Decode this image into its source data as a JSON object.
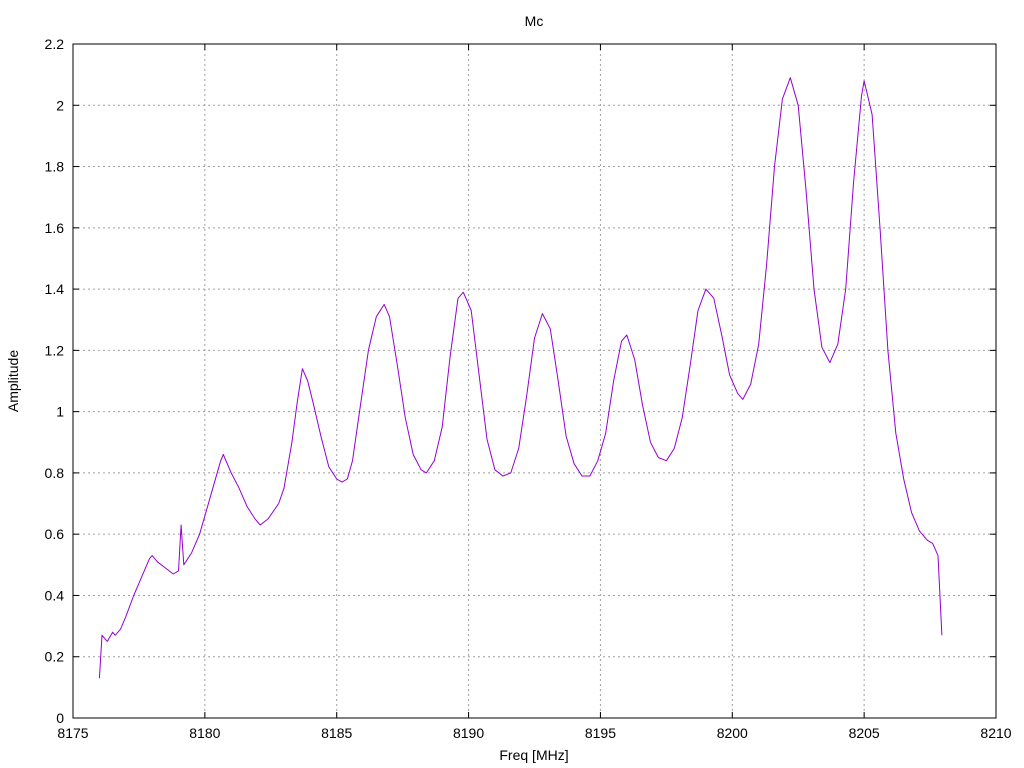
{
  "chart_data": {
    "type": "line",
    "title": "Mc",
    "xlabel": "Freq [MHz]",
    "ylabel": "Amplitude",
    "xlim": [
      8175,
      8210
    ],
    "ylim": [
      0,
      2.2
    ],
    "xticks": [
      8175,
      8180,
      8185,
      8190,
      8195,
      8200,
      8205,
      8210
    ],
    "yticks": [
      0,
      0.2,
      0.4,
      0.6,
      0.8,
      1,
      1.2,
      1.4,
      1.6,
      1.8,
      2,
      2.2
    ],
    "ytick_labels": [
      "0",
      "0.2",
      "0.4",
      "0.6",
      "0.8",
      "1",
      "1.2",
      "1.4",
      "1.6",
      "1.8",
      "2",
      "2.2"
    ],
    "grid": true,
    "line_color": "#9400d3",
    "series": [
      {
        "points": [
          [
            8176.0,
            0.13
          ],
          [
            8176.1,
            0.27
          ],
          [
            8176.3,
            0.25
          ],
          [
            8176.5,
            0.28
          ],
          [
            8176.6,
            0.27
          ],
          [
            8176.8,
            0.29
          ],
          [
            8177.0,
            0.33
          ],
          [
            8177.3,
            0.4
          ],
          [
            8177.6,
            0.46
          ],
          [
            8177.9,
            0.52
          ],
          [
            8178.0,
            0.53
          ],
          [
            8178.2,
            0.51
          ],
          [
            8178.5,
            0.49
          ],
          [
            8178.8,
            0.47
          ],
          [
            8179.0,
            0.48
          ],
          [
            8179.1,
            0.63
          ],
          [
            8179.2,
            0.5
          ],
          [
            8179.5,
            0.54
          ],
          [
            8179.8,
            0.6
          ],
          [
            8180.0,
            0.66
          ],
          [
            8180.3,
            0.75
          ],
          [
            8180.6,
            0.84
          ],
          [
            8180.7,
            0.86
          ],
          [
            8181.0,
            0.8
          ],
          [
            8181.3,
            0.75
          ],
          [
            8181.6,
            0.69
          ],
          [
            8181.9,
            0.65
          ],
          [
            8182.1,
            0.63
          ],
          [
            8182.4,
            0.65
          ],
          [
            8182.8,
            0.7
          ],
          [
            8183.0,
            0.75
          ],
          [
            8183.3,
            0.9
          ],
          [
            8183.5,
            1.03
          ],
          [
            8183.7,
            1.14
          ],
          [
            8183.9,
            1.1
          ],
          [
            8184.1,
            1.03
          ],
          [
            8184.4,
            0.92
          ],
          [
            8184.7,
            0.82
          ],
          [
            8185.0,
            0.78
          ],
          [
            8185.2,
            0.77
          ],
          [
            8185.4,
            0.78
          ],
          [
            8185.6,
            0.84
          ],
          [
            8185.9,
            1.02
          ],
          [
            8186.2,
            1.2
          ],
          [
            8186.5,
            1.31
          ],
          [
            8186.8,
            1.35
          ],
          [
            8187.0,
            1.31
          ],
          [
            8187.3,
            1.15
          ],
          [
            8187.6,
            0.98
          ],
          [
            8187.9,
            0.86
          ],
          [
            8188.2,
            0.81
          ],
          [
            8188.4,
            0.8
          ],
          [
            8188.7,
            0.84
          ],
          [
            8189.0,
            0.95
          ],
          [
            8189.3,
            1.18
          ],
          [
            8189.6,
            1.37
          ],
          [
            8189.8,
            1.39
          ],
          [
            8190.1,
            1.33
          ],
          [
            8190.4,
            1.12
          ],
          [
            8190.7,
            0.91
          ],
          [
            8191.0,
            0.81
          ],
          [
            8191.3,
            0.79
          ],
          [
            8191.6,
            0.8
          ],
          [
            8191.9,
            0.88
          ],
          [
            8192.2,
            1.05
          ],
          [
            8192.5,
            1.24
          ],
          [
            8192.8,
            1.32
          ],
          [
            8193.1,
            1.27
          ],
          [
            8193.4,
            1.1
          ],
          [
            8193.7,
            0.92
          ],
          [
            8194.0,
            0.83
          ],
          [
            8194.3,
            0.79
          ],
          [
            8194.6,
            0.79
          ],
          [
            8194.9,
            0.84
          ],
          [
            8195.2,
            0.93
          ],
          [
            8195.5,
            1.1
          ],
          [
            8195.8,
            1.23
          ],
          [
            8196.0,
            1.25
          ],
          [
            8196.3,
            1.17
          ],
          [
            8196.6,
            1.02
          ],
          [
            8196.9,
            0.9
          ],
          [
            8197.2,
            0.85
          ],
          [
            8197.5,
            0.84
          ],
          [
            8197.8,
            0.88
          ],
          [
            8198.1,
            0.98
          ],
          [
            8198.4,
            1.15
          ],
          [
            8198.7,
            1.33
          ],
          [
            8199.0,
            1.4
          ],
          [
            8199.3,
            1.37
          ],
          [
            8199.6,
            1.25
          ],
          [
            8199.9,
            1.12
          ],
          [
            8200.2,
            1.06
          ],
          [
            8200.4,
            1.04
          ],
          [
            8200.7,
            1.09
          ],
          [
            8201.0,
            1.22
          ],
          [
            8201.3,
            1.48
          ],
          [
            8201.6,
            1.8
          ],
          [
            8201.9,
            2.02
          ],
          [
            8202.2,
            2.09
          ],
          [
            8202.5,
            2.0
          ],
          [
            8202.8,
            1.72
          ],
          [
            8203.1,
            1.4
          ],
          [
            8203.4,
            1.21
          ],
          [
            8203.7,
            1.16
          ],
          [
            8204.0,
            1.22
          ],
          [
            8204.3,
            1.4
          ],
          [
            8204.6,
            1.75
          ],
          [
            8204.9,
            2.03
          ],
          [
            8205.0,
            2.08
          ],
          [
            8205.3,
            1.97
          ],
          [
            8205.6,
            1.6
          ],
          [
            8205.9,
            1.2
          ],
          [
            8206.2,
            0.93
          ],
          [
            8206.5,
            0.78
          ],
          [
            8206.8,
            0.67
          ],
          [
            8207.1,
            0.61
          ],
          [
            8207.4,
            0.58
          ],
          [
            8207.6,
            0.57
          ],
          [
            8207.8,
            0.53
          ],
          [
            8207.95,
            0.27
          ]
        ]
      }
    ]
  }
}
